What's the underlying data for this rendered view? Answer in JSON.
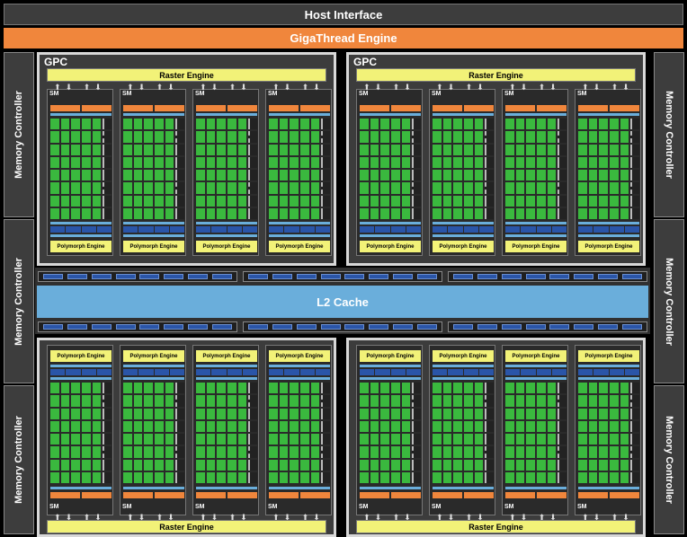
{
  "host_interface": "Host Interface",
  "gigathread": "GigaThread Engine",
  "memory_controller": "Memory Controller",
  "l2_cache": "L2 Cache",
  "gpc_label": "GPC",
  "raster_engine": "Raster Engine",
  "sm_label": "SM",
  "polymorph_engine": "Polymorph Engine",
  "arrows": "⬆⬇ ⬆⬇",
  "colors": {
    "accent": "#f0863c",
    "l2": "#6aaedb",
    "core": "#3ab93e",
    "engine": "#f2f278"
  }
}
